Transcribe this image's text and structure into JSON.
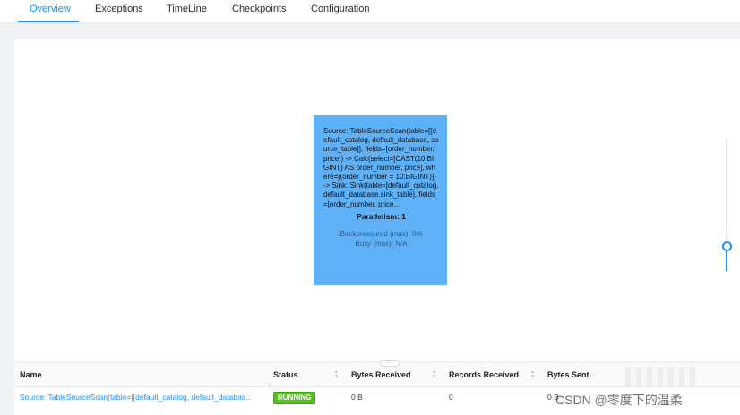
{
  "tabs": [
    {
      "label": "Overview",
      "active": true
    },
    {
      "label": "Exceptions",
      "active": false
    },
    {
      "label": "TimeLine",
      "active": false
    },
    {
      "label": "Checkpoints",
      "active": false
    },
    {
      "label": "Configuration",
      "active": false
    }
  ],
  "colors": {
    "accent": "#1890ff",
    "node_fill": "#5eb0f7",
    "running": "#52c41a"
  },
  "graph": {
    "node": {
      "description": "Source: TableSourceScan(table=[[default_catalog, default_database, source_table]], fields=[order_number, price]) -> Calc(select=[CAST(10:BIGINT) AS order_number, price], where=[(order_number = 10:BIGINT)]) -> Sink: Sink(table=[default_catalog.default_database.sink_table], fields=[order_number, price...",
      "parallelism": "Parallelism: 1",
      "backpressured": "Backpressured (max): 0%",
      "busy": "Busy (max): N/A"
    }
  },
  "table": {
    "columns": [
      "Name",
      "Status",
      "Bytes Received",
      "Records Received",
      "Bytes Sent"
    ],
    "rows": [
      {
        "name": "Source: TableSourceScan(table=[[default_catalog, default_databas...",
        "status": "RUNNING",
        "bytes_received": "0 B",
        "records_received": "0",
        "bytes_sent": "0 B"
      }
    ]
  },
  "watermark": "CSDN @零度下的温柔"
}
